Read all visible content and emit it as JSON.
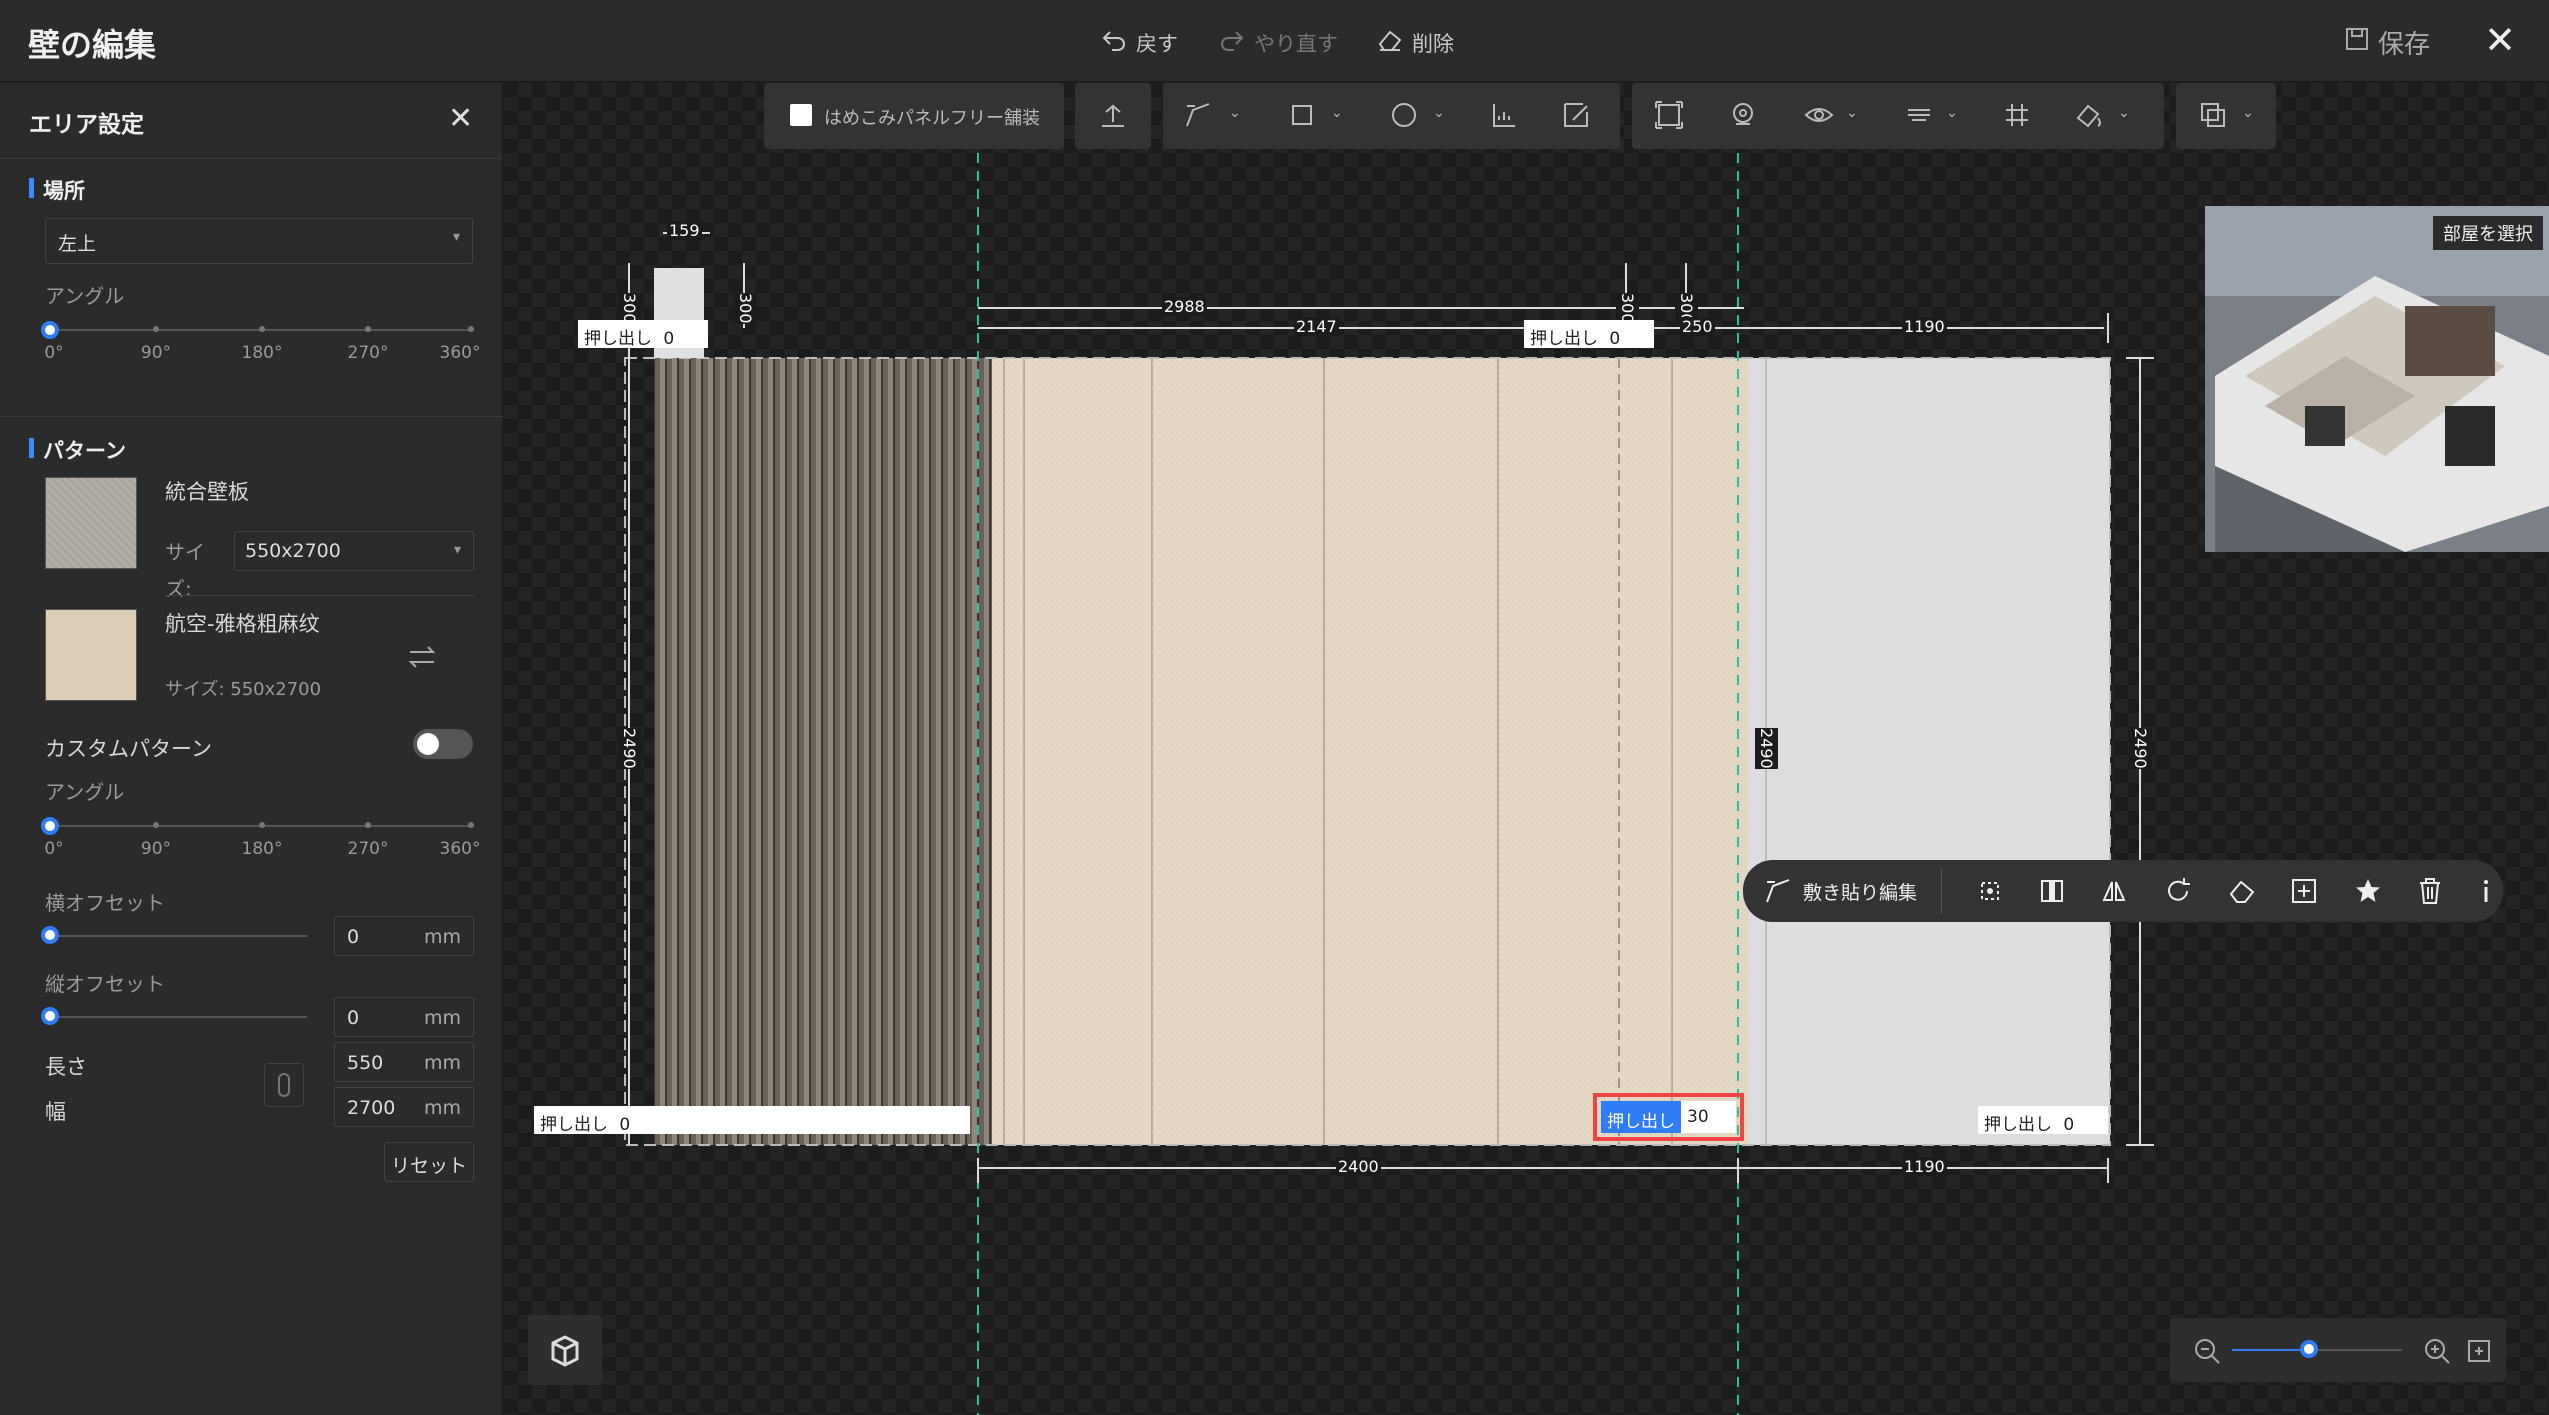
{
  "titlebar": {
    "title": "壁の編集",
    "undo": "戻す",
    "redo": "やり直す",
    "delete": "削除",
    "save": "保存"
  },
  "panel": {
    "title": "エリア設定",
    "location_section": "場所",
    "location_value": "左上",
    "angle_label": "アングル",
    "angle_ticks": [
      "0°",
      "90°",
      "180°",
      "270°",
      "360°"
    ],
    "pattern_section": "パターン",
    "pattern1_name": "統合壁板",
    "size_label": "サイ",
    "size_label2": "ズ:",
    "pattern1_size": "550x2700",
    "pattern2_name": "航空-雅格粗麻纹",
    "pattern2_size": "サイズ: 550x2700",
    "custom_pattern": "カスタムパターン",
    "angle2_label": "アングル",
    "h_offset_label": "横オフセット",
    "h_offset_value": "0",
    "v_offset_label": "縦オフセット",
    "v_offset_value": "0",
    "unit": "mm",
    "length_label": "長さ",
    "length_value": "550",
    "width_label": "幅",
    "width_value": "2700",
    "reset": "リセット"
  },
  "toolbar": {
    "freepaving_label": "はめこみパネルフリー舗装"
  },
  "dimensions": {
    "top_159": "159",
    "top_300a": "300",
    "top_300b": "300",
    "top_2988": "2988",
    "top_2147": "2147",
    "top_300c": "300",
    "top_300d": "300",
    "top_250": "250",
    "top_1190": "1190",
    "side_2490": "2490",
    "right_2490": "2490",
    "bottom_2400": "2400",
    "bottom_1190": "1190"
  },
  "push_labels": {
    "label": "押し出し",
    "tl_value": "0",
    "tm_value": "0",
    "bl_value": "0",
    "br_value": "0",
    "sel_value": "30"
  },
  "float_toolbar": {
    "label": "敷き貼り編集"
  },
  "minimap": {
    "select_room": "部屋を選択"
  },
  "zoom": {
    "level_fraction": 0.45
  }
}
